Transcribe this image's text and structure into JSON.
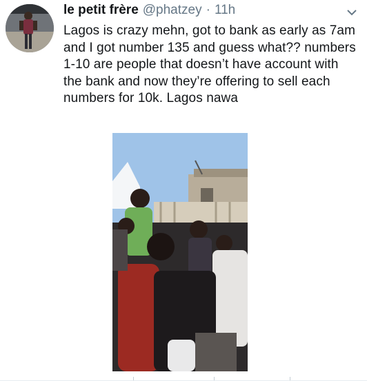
{
  "tweet": {
    "display_name": "le petit frère",
    "handle": "@phatzey",
    "separator": "·",
    "time": "11h",
    "text": "Lagos is crazy mehn, got to bank as early as 7am and I got number 135 and guess what?? numbers 1-10 are people that doesn’t have account with the bank and now they’re offering to sell each numbers for 10k. Lagos nawa"
  },
  "icons": {
    "menu": "chevron-down-icon"
  },
  "colors": {
    "text": "#14171a",
    "secondary": "#657786",
    "sky": "#9fc3e8"
  }
}
